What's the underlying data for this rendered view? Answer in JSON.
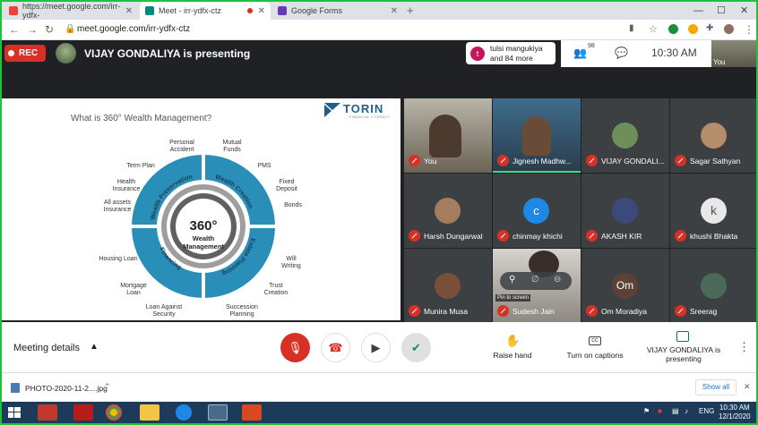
{
  "browser": {
    "tabs": [
      {
        "title": "https://meet.google.com/irr-ydfx-",
        "favicon": "gmail-icon"
      },
      {
        "title": "Meet - irr-ydfx-ctz",
        "favicon": "meet-icon",
        "active": true
      },
      {
        "title": "Google Forms",
        "favicon": "forms-icon"
      }
    ],
    "url": "meet.google.com/irr-ydfx-ctz",
    "new_tab_label": "+"
  },
  "meet": {
    "rec_label": "REC",
    "presenting_title": "VIJAY GONDALIYA is presenting",
    "joined": {
      "initial": "t",
      "line1": "tulsi mangukiya",
      "line2": "and 84 more"
    },
    "people_count": "98",
    "clock": "10:30 AM",
    "self_label": "You"
  },
  "slide": {
    "title": "What is 360° Wealth Management?",
    "brand": "TORIN",
    "brand_sub": "FINANCIAL LITERACY",
    "center_big": "360°",
    "center_sub1": "Wealth",
    "center_sub2": "Management",
    "segments": [
      "Wealth Preservation",
      "Wealth Creation",
      "Estate Planning",
      "Financing"
    ],
    "labels": {
      "personal_accident": "Personal Accident",
      "term_plan": "Term Plan",
      "health_insurance": "Health Insurance",
      "all_assets": "All assets Insurance",
      "mutual_funds": "Mutual Funds",
      "pms": "PMS",
      "fixed_deposit": "Fixed Deposit",
      "bonds": "Bonds",
      "will_writing": "Will Writing",
      "trust_creation": "Trust Creation",
      "succession": "Succession Planning",
      "loan_security": "Loan Against Security",
      "mortgage_loan": "Mortgage Loan",
      "housing_loan": "Housing Loan"
    }
  },
  "participants": [
    {
      "name": "You",
      "type": "video"
    },
    {
      "name": "Jignesh Madhw...",
      "type": "video"
    },
    {
      "name": "VIJAY GONDALI...",
      "type": "avatar",
      "color": "#6f8f5a"
    },
    {
      "name": "Sagar Sathyan",
      "type": "avatar",
      "color": "#b58d6a"
    },
    {
      "name": "Harsh Dungarwal",
      "type": "avatar",
      "color": "#a47d5e"
    },
    {
      "name": "chinmay khichi",
      "type": "letter",
      "letter": "c",
      "color": "#1e88e5"
    },
    {
      "name": "AKASH KIR",
      "type": "avatar",
      "color": "#3b4a7a"
    },
    {
      "name": "khushi Bhakta",
      "type": "letter",
      "letter": "k",
      "color": "#e8e8e8"
    },
    {
      "name": "Munira Musa",
      "type": "avatar",
      "color": "#7a4f3a"
    },
    {
      "name": "Sudesh Jain",
      "type": "video",
      "pin_label": "Pin to screen"
    },
    {
      "name": "Om Moradiya",
      "type": "letter",
      "letter": "Om",
      "color": "#5d4037"
    },
    {
      "name": "Sreerag",
      "type": "avatar",
      "color": "#4a6a5a"
    }
  ],
  "bottom": {
    "meeting_details": "Meeting details",
    "raise_hand": "Raise hand",
    "captions": "Turn on captions",
    "presenting": "VIJAY GONDALIYA is presenting"
  },
  "download": {
    "file": "PHOTO-2020-11-2....jpg",
    "show_all": "Show all"
  },
  "taskbar": {
    "lang": "ENG",
    "time": "10:30 AM",
    "date": "12/1/2020"
  }
}
